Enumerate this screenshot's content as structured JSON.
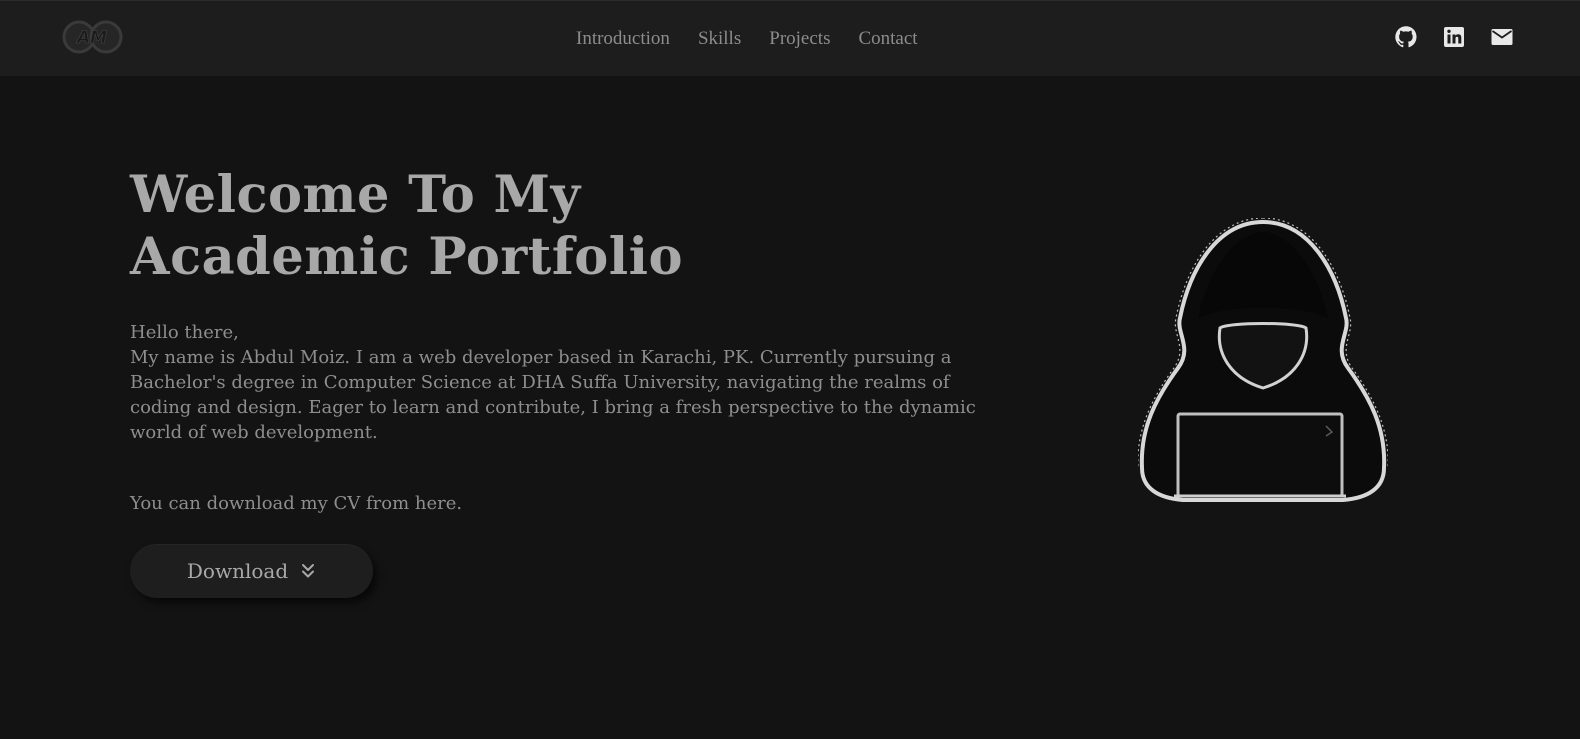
{
  "navbar": {
    "logo_text": "AM",
    "links": [
      "Introduction",
      "Skills",
      "Projects",
      "Contact"
    ],
    "socials": [
      "github-icon",
      "linkedin-icon",
      "mail-icon"
    ]
  },
  "hero": {
    "title_line1": "Welcome To My",
    "title_line2": "Academic Portfolio",
    "greeting": "Hello there,",
    "bio": "My name is Abdul Moiz. I am a web developer based in Karachi, PK. Currently pursuing a Bachelor's degree in Computer Science at DHA Suffa University, navigating the realms of coding and design. Eager to learn and contribute, I bring a fresh perspective to the dynamic world of web development.",
    "cv_text": "You can download my CV from here.",
    "download_label": "Download"
  },
  "illustration": {
    "name": "hooded-hacker-with-laptop"
  }
}
